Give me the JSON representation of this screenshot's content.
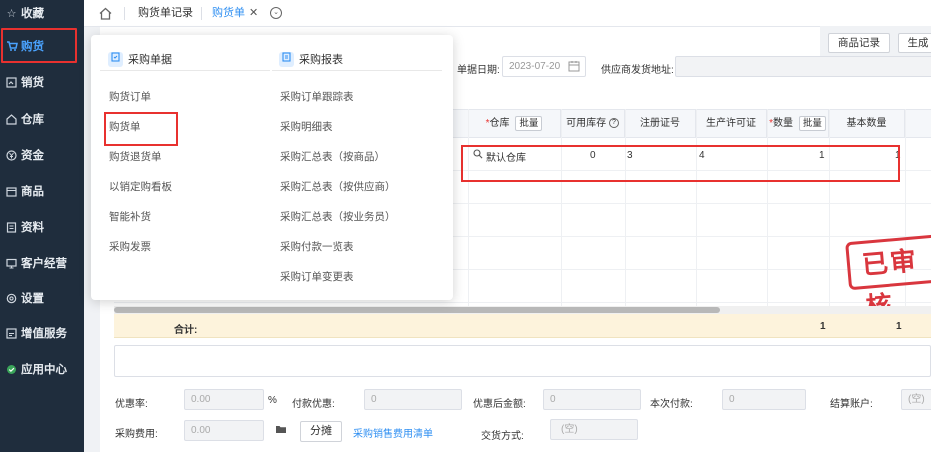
{
  "sidebar": {
    "items": [
      {
        "label": "收藏",
        "icon": "star-icon"
      },
      {
        "label": "购货",
        "icon": "cart-icon",
        "active": true
      },
      {
        "label": "销货",
        "icon": "sales-icon"
      },
      {
        "label": "仓库",
        "icon": "warehouse-icon"
      },
      {
        "label": "资金",
        "icon": "yen-icon"
      },
      {
        "label": "商品",
        "icon": "goods-icon"
      },
      {
        "label": "资料",
        "icon": "file-icon"
      },
      {
        "label": "客户经营",
        "icon": "monitor-icon"
      },
      {
        "label": "设置",
        "icon": "gear-icon"
      },
      {
        "label": "增值服务",
        "icon": "service-icon"
      },
      {
        "label": "应用中心",
        "icon": "app-center-icon"
      }
    ]
  },
  "tabs": [
    {
      "label": "购货单记录"
    },
    {
      "label": "购货单",
      "active": true
    }
  ],
  "actions": {
    "product_record": "商品记录",
    "generate": "生成"
  },
  "form": {
    "date_label": "单据日期:",
    "date_value": "2023-07-20",
    "address_label": "供应商发货地址:"
  },
  "grid": {
    "headers": {
      "warehouse": "仓库",
      "batch": "批量",
      "stock": "可用库存",
      "reg_no": "注册证号",
      "license": "生产许可证",
      "qty": "数量",
      "base_qty": "基本数量"
    },
    "row": {
      "warehouse": "默认仓库",
      "stock": "0",
      "reg_no": "3",
      "license": "4",
      "qty": "1",
      "base_qty": "1"
    },
    "total_label": "合计:",
    "total_qty": "1",
    "total_base_qty": "1"
  },
  "stamp": "已审核",
  "footer": {
    "discount_rate_label": "优惠率:",
    "discount_rate_value": "0.00",
    "percent": "%",
    "pay_discount_label": "付款优惠:",
    "pay_discount_value": "0",
    "after_discount_label": "优惠后金额:",
    "after_discount_value": "0",
    "this_payment_label": "本次付款:",
    "this_payment_value": "0",
    "account_label": "结算账户:",
    "account_value": "(空)",
    "purchase_fee_label": "采购费用:",
    "purchase_fee_value": "0.00",
    "allocate_button": "分摊",
    "fee_list_link": "采购销售费用清单",
    "trade_method_label": "交货方式:",
    "trade_method_value": "(空)"
  },
  "dropdown": {
    "left_title": "采购单据",
    "right_title": "采购报表",
    "left_items": [
      "购货订单",
      "购货单",
      "购货退货单",
      "以销定购看板",
      "智能补货",
      "采购发票"
    ],
    "right_items": [
      "采购订单跟踪表",
      "采购明细表",
      "采购汇总表（按商品）",
      "采购汇总表（按供应商）",
      "采购汇总表（按业务员）",
      "采购付款一览表",
      "采购订单变更表"
    ]
  }
}
